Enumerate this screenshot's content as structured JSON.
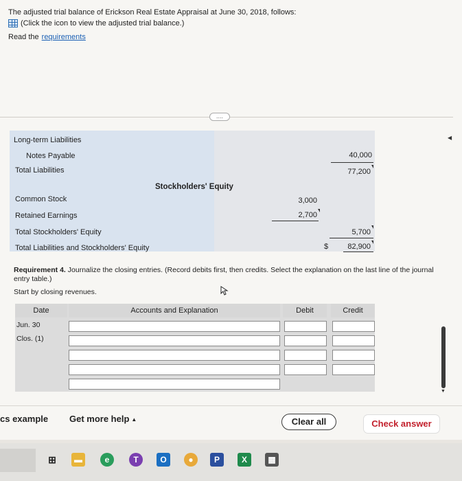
{
  "intro": {
    "line1": "The adjusted trial balance of Erickson Real Estate Appraisal at June 30, 2018, follows:",
    "line2": "(Click the icon to view the adjusted trial balance.)",
    "read_prefix": "Read the",
    "read_link": "requirements"
  },
  "expander_label": "....",
  "balance_sheet": {
    "long_term_liabilities": "Long-term Liabilities",
    "notes_payable": "Notes Payable",
    "notes_payable_value": "40,000",
    "total_liabilities": "Total Liabilities",
    "total_liabilities_value": "77,200",
    "se_header": "Stockholders' Equity",
    "common_stock": "Common Stock",
    "common_stock_value": "3,000",
    "retained_earnings": "Retained Earnings",
    "retained_earnings_value": "2,700",
    "total_se": "Total Stockholders' Equity",
    "total_se_value": "5,700",
    "total_l_se": "Total Liabilities and Stockholders' Equity",
    "dollar": "$",
    "total_l_se_value": "82,900"
  },
  "requirement": {
    "bold": "Requirement 4.",
    "text": " Journalize the closing entries. (Record debits first, then credits. Select the explanation on the last line of the journal entry table.)"
  },
  "start_text": "Start by closing revenues.",
  "journal": {
    "headers": {
      "date": "Date",
      "accounts": "Accounts and Explanation",
      "debit": "Debit",
      "credit": "Credit"
    },
    "date_line1": "Jun. 30",
    "date_line2": "Clos. (1)"
  },
  "footer": {
    "example": "cs example",
    "help": "Get more help",
    "clear_all": "Clear all",
    "check_answer": "Check answer"
  },
  "colors": {
    "accent_red": "#c21f2b",
    "link_blue": "#1a5fb4"
  }
}
